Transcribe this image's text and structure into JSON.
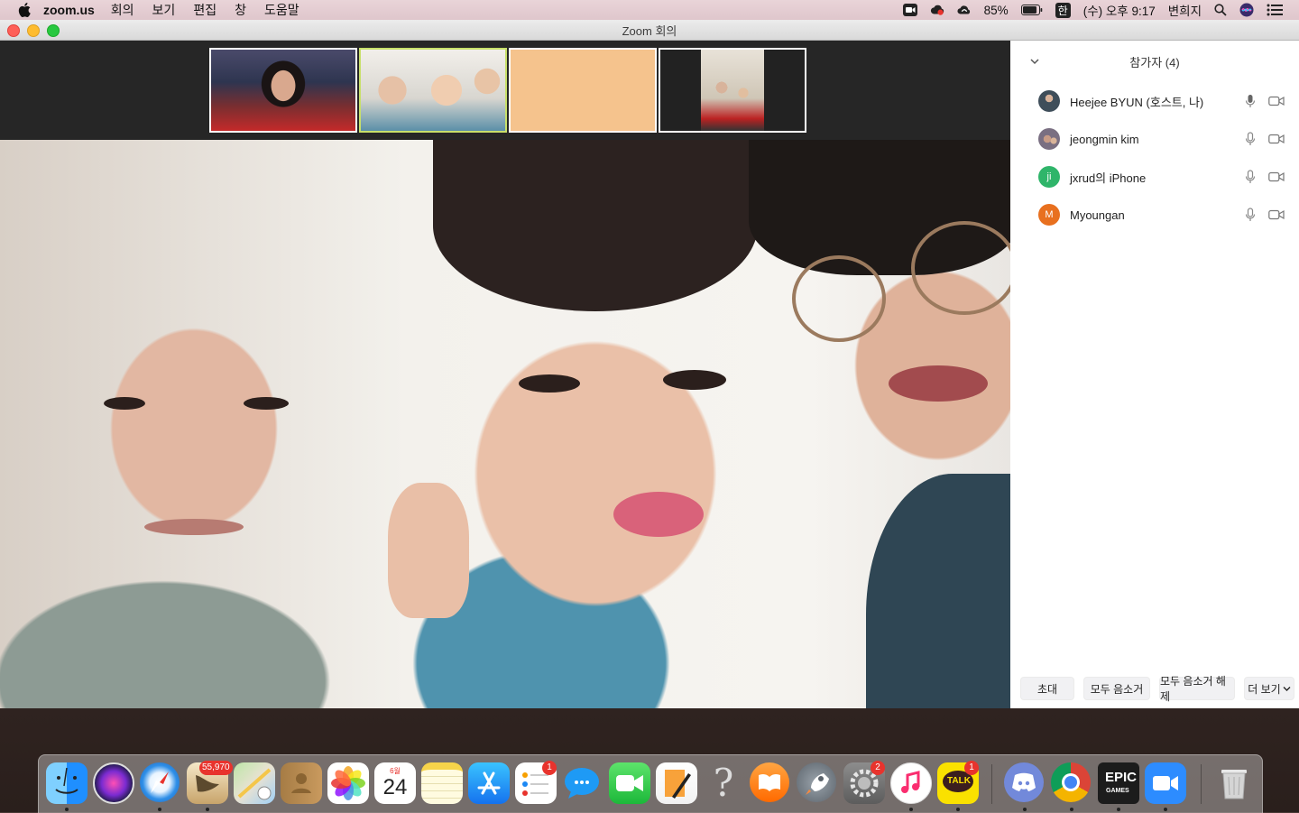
{
  "menubar": {
    "app_name": "zoom.us",
    "menus": [
      "회의",
      "보기",
      "편집",
      "창",
      "도움말"
    ],
    "battery": "85%",
    "input_method": "한",
    "datetime": "(수) 오후 9:17",
    "user": "변희지"
  },
  "window": {
    "title": "Zoom 회의"
  },
  "participants_panel": {
    "header": "참가자 (4)",
    "participants": [
      {
        "name": "Heejee BYUN (호스트, 나)",
        "avatar_type": "photo",
        "avatar_color": "#5a6b78"
      },
      {
        "name": "jeongmin kim",
        "avatar_type": "photo",
        "avatar_color": "#6a5f70"
      },
      {
        "name": "jxrud의 iPhone",
        "avatar_type": "initials",
        "initials": "ji",
        "avatar_color": "#2fb56a"
      },
      {
        "name": "Myoungan",
        "avatar_type": "initials",
        "initials": "M",
        "avatar_color": "#e8701f"
      }
    ],
    "buttons": {
      "invite": "초대",
      "mute_all": "모두 음소거",
      "unmute_all": "모두 음소거 해제",
      "more": "더 보기"
    }
  },
  "dock": {
    "mail_badge": "55,970",
    "calendar_month": "6월",
    "calendar_day": "24",
    "reminders_badge": "1",
    "settings_badge": "2",
    "kakaotalk_badge": "1",
    "kakaotalk_label": "TALK",
    "epic_label": "EPIC",
    "epic_sub": "GAMES",
    "help_glyph": "?"
  }
}
